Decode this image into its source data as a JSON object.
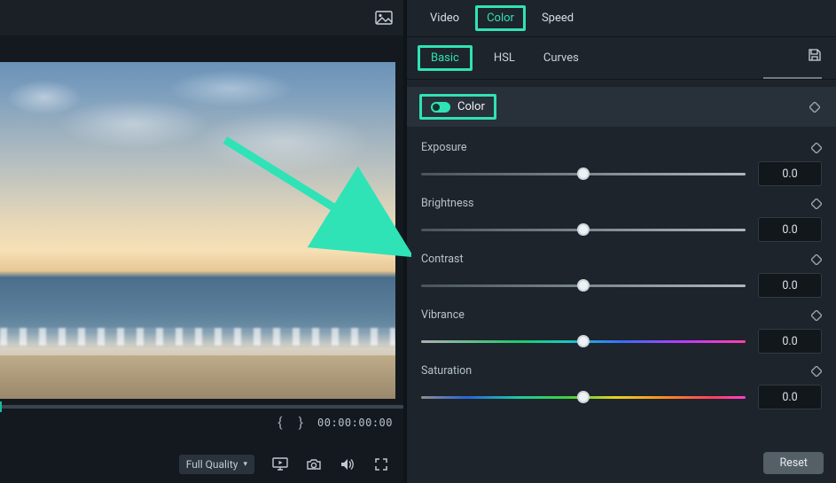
{
  "colors": {
    "accent": "#2fe3b6"
  },
  "left": {
    "picture_icon": "image-icon",
    "mark_in": "{",
    "mark_out": "}",
    "timecode": "00:00:00:00",
    "quality_label": "Full Quality",
    "controls": {
      "render": "monitor-play-icon",
      "snapshot": "camera-icon",
      "audio": "speaker-icon",
      "fullscreen": "fullscreen-icon"
    }
  },
  "tabs": {
    "main": [
      "Video",
      "Color",
      "Speed"
    ],
    "main_active": "Color",
    "sub": [
      "Basic",
      "HSL",
      "Curves"
    ],
    "sub_active": "Basic"
  },
  "section": {
    "toggle_on": true,
    "label": "Color"
  },
  "params": [
    {
      "key": "exposure",
      "label": "Exposure",
      "value": "0.0",
      "pos": 50,
      "track": "gray"
    },
    {
      "key": "brightness",
      "label": "Brightness",
      "value": "0.0",
      "pos": 50,
      "track": "gray"
    },
    {
      "key": "contrast",
      "label": "Contrast",
      "value": "0.0",
      "pos": 50,
      "track": "gray"
    },
    {
      "key": "vibrance",
      "label": "Vibrance",
      "value": "0.0",
      "pos": 50,
      "track": "vib"
    },
    {
      "key": "saturation",
      "label": "Saturation",
      "value": "0.0",
      "pos": 50,
      "track": "sat"
    }
  ],
  "reset_label": "Reset"
}
